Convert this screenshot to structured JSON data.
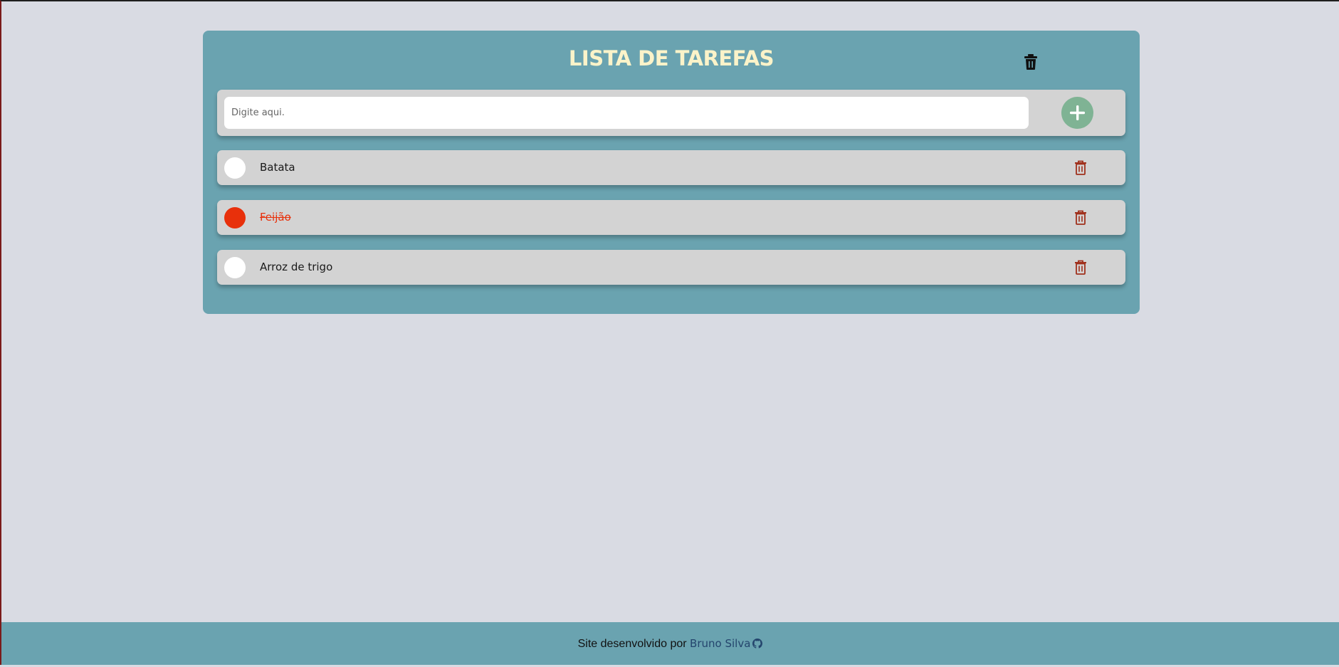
{
  "header": {
    "title": "LISTA DE TAREFAS",
    "clear_icon": "trash-icon"
  },
  "input": {
    "placeholder": "Digite aqui.",
    "value": "",
    "add_icon": "plus-icon"
  },
  "tasks": [
    {
      "text": "Batata",
      "done": false
    },
    {
      "text": "Feijão",
      "done": true
    },
    {
      "text": "Arroz de trigo",
      "done": false
    }
  ],
  "footer": {
    "text": "Site desenvolvido por",
    "author": "Bruno Silva",
    "icon": "github-icon"
  },
  "colors": {
    "background": "#d9dbe3",
    "card": "#6aa3b0",
    "title": "#fbf3c9",
    "row": "#d3d3d3",
    "add_button": "#7fb394",
    "done": "#e8300b",
    "delete_icon": "#a0301c",
    "author_link": "#24456d"
  }
}
